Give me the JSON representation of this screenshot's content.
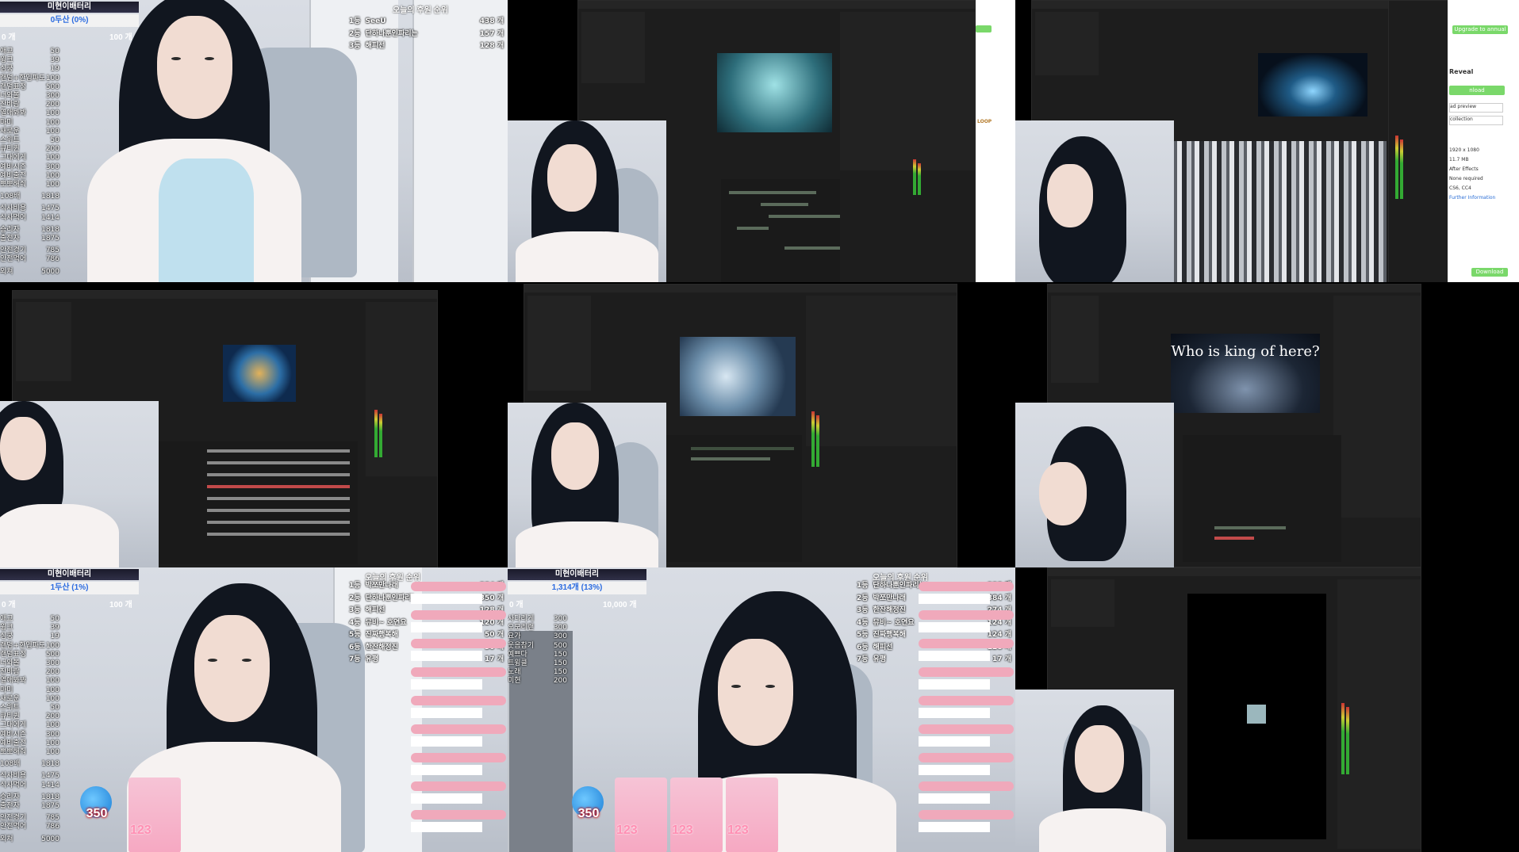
{
  "overlay": {
    "channel_title": "미현이배터리",
    "tile1_progress": "0두산 (0%)",
    "tile7_progress": "1두산 (1%)",
    "tile8_progress": "1,314개 (13%)",
    "range_min": "0 개",
    "range_max": "100 개",
    "range_max_10000": "10,000 개",
    "rank_title": "오늘의 후원 순위",
    "menu_items": [
      {
        "label": "애교",
        "value": "50"
      },
      {
        "label": "윙크",
        "value": "39"
      },
      {
        "label": "심쿵",
        "value": "19"
      },
      {
        "label": "랜덤+한입파도",
        "value": "100"
      },
      {
        "label": "랜덤표정",
        "value": "500"
      },
      {
        "label": "너와볼",
        "value": "300"
      },
      {
        "label": "잔바람",
        "value": "200"
      },
      {
        "label": "열애봐봐",
        "value": "100"
      },
      {
        "label": "마미",
        "value": "100"
      },
      {
        "label": "새로운",
        "value": "100"
      },
      {
        "label": "스위트",
        "value": "50"
      },
      {
        "label": "큐티퀸",
        "value": "200"
      },
      {
        "label": "그대에게",
        "value": "100"
      },
      {
        "label": "예비시즌",
        "value": "300"
      },
      {
        "label": "예비출전",
        "value": "100"
      },
      {
        "label": "뽀뽀해줘",
        "value": "100"
      }
    ],
    "menu_extra": [
      {
        "label": "108배",
        "value": "1818"
      },
      {
        "label": "식사비용",
        "value": "1475"
      },
      {
        "label": "식사먹어",
        "value": "1414"
      },
      {
        "label": "승리자",
        "value": "1818"
      },
      {
        "label": "출전자",
        "value": "1875"
      },
      {
        "label": "안전경기",
        "value": "785"
      },
      {
        "label": "안전먹어",
        "value": "786"
      },
      {
        "label": "외쳐",
        "value": "5000"
      }
    ],
    "tile8_menu": [
      {
        "label": "사다리게",
        "value": "300"
      },
      {
        "label": "오모리랜",
        "value": "300"
      },
      {
        "label": "요가",
        "value": "300"
      },
      {
        "label": "웃음참기",
        "value": "500"
      },
      {
        "label": "예쁘다",
        "value": "150"
      },
      {
        "label": "트윙클",
        "value": "150"
      },
      {
        "label": "노래",
        "value": "150"
      },
      {
        "label": "미현",
        "value": "200"
      }
    ],
    "rank_tile1": [
      {
        "pos": "1등",
        "name": "SeeU",
        "value": "438 개"
      },
      {
        "pos": "2등",
        "name": "단하나뿐인파리는",
        "value": "157 개"
      },
      {
        "pos": "3등",
        "name": "해피선",
        "value": "128 개"
      }
    ],
    "rank_tile7": [
      {
        "pos": "1등",
        "name": "박쪼만나래",
        "value": "384 개"
      },
      {
        "pos": "2등",
        "name": "단하나뿐인파리는",
        "value": "350 개"
      },
      {
        "pos": "3등",
        "name": "해피선",
        "value": "128 개"
      },
      {
        "pos": "4등",
        "name": "뮤비~ 호연요",
        "value": "120 개"
      },
      {
        "pos": "5등",
        "name": "진짜행복해",
        "value": "50 개"
      },
      {
        "pos": "6등",
        "name": "한잔해정진",
        "value": "30 개"
      },
      {
        "pos": "7등",
        "name": "유평",
        "value": "17 개"
      }
    ],
    "rank_tile8": [
      {
        "pos": "1등",
        "name": "단하나뿐인파리는",
        "value": "388 개"
      },
      {
        "pos": "2등",
        "name": "박쪼만나래",
        "value": "384 개"
      },
      {
        "pos": "3등",
        "name": "한잔해정진",
        "value": "274 개"
      },
      {
        "pos": "4등",
        "name": "뮤비~ 호연요",
        "value": "124 개"
      },
      {
        "pos": "5등",
        "name": "진짜행복해",
        "value": "124 개"
      },
      {
        "pos": "6등",
        "name": "해피선",
        "value": "128 개"
      },
      {
        "pos": "7등",
        "name": "유평",
        "value": "17 개"
      }
    ],
    "badge_number": "350",
    "card_number": "123"
  },
  "ae": {
    "comp_caption": "Who is king of here?"
  },
  "browser": {
    "upgrade_label": "Upgrade to annual",
    "reveal_label": "Reveal",
    "loop_label": "LOOP",
    "download_label": "Download",
    "side_items": [
      "1920 x 1080",
      "11.7 MB",
      "After Effects",
      "None required",
      "CS6, CC4",
      "Further Information"
    ],
    "rows": [
      "nload",
      "ad preview",
      "collection"
    ]
  },
  "colors": {
    "ae_panel": "#1d1d1d",
    "overlay_pink": "#f0a9bb",
    "green_button": "#7ad86a"
  }
}
